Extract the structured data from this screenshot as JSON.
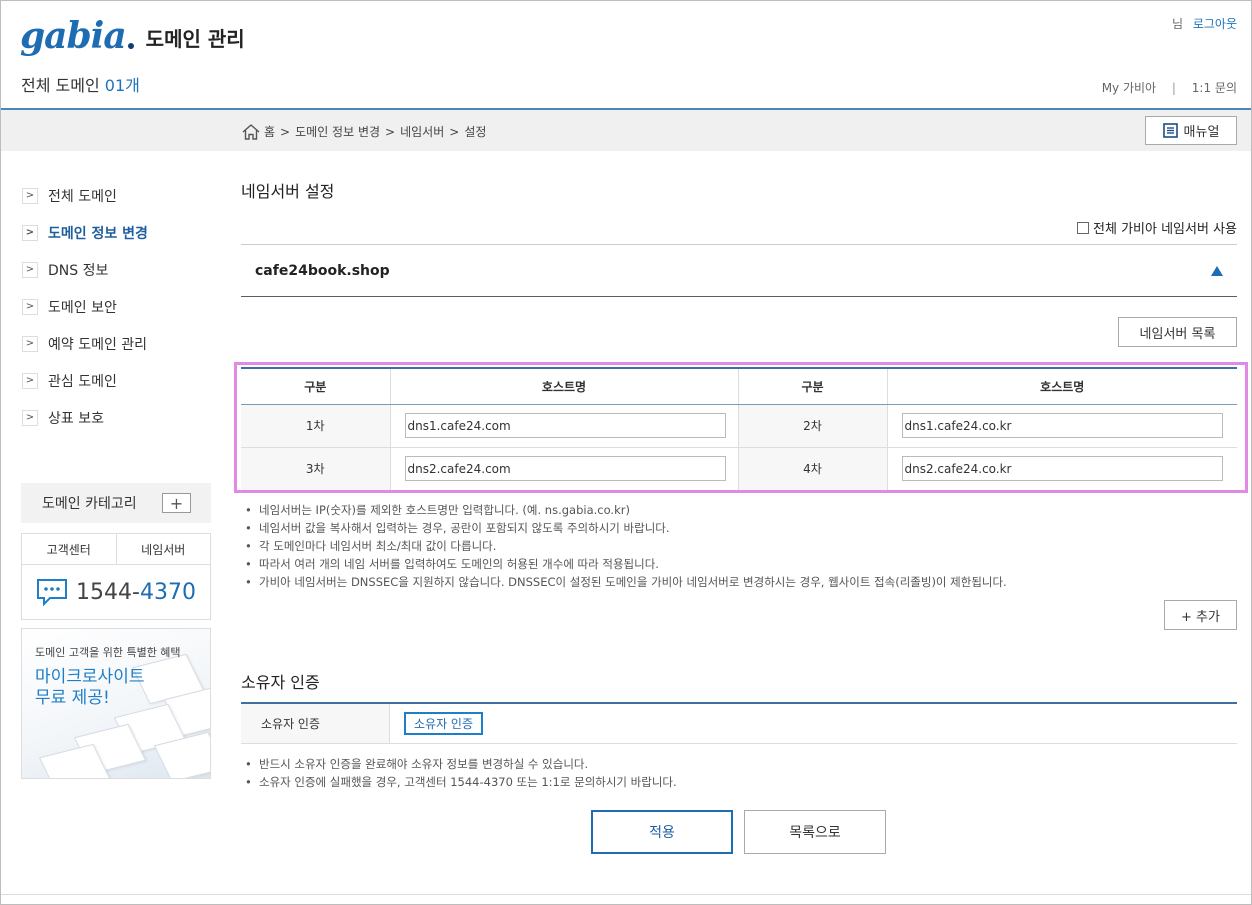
{
  "header": {
    "logo_text": "gabia",
    "title": "도메인 관리",
    "count_label": "전체 도메인",
    "count_value": "01개",
    "user_suffix": "님",
    "logout": "로그아웃",
    "my_gabia": "My 가비아",
    "separator": "|",
    "inquiry": "1:1 문의"
  },
  "breadcrumb": {
    "items": [
      "홈",
      ">",
      "도메인 정보 변경",
      ">",
      "네임서버",
      ">",
      "설정"
    ],
    "manual_button": "매뉴얼"
  },
  "sidebar": {
    "items": [
      {
        "label": "전체 도메인",
        "active": false
      },
      {
        "label": "도메인 정보 변경",
        "active": true
      },
      {
        "label": "DNS 정보",
        "active": false
      },
      {
        "label": "도메인 보안",
        "active": false
      },
      {
        "label": "예약 도메인 관리",
        "active": false
      },
      {
        "label": "관심 도메인",
        "active": false
      },
      {
        "label": "상표 보호",
        "active": false
      }
    ],
    "chevron": ">",
    "category_label": "도메인 카테고리",
    "category_plus": "+",
    "cs_tabs": [
      "고객센터",
      "네임서버"
    ],
    "phone_a": "1544-",
    "phone_b": "4370",
    "promo_small": "도메인 고객을 위한 특별한 혜택",
    "promo_big_1": "마이크로사이트",
    "promo_big_2": "무료 제공!"
  },
  "main": {
    "title": "네임서버 설정",
    "all_gabia_label": "전체 가비아 네임서버 사용",
    "domain": "cafe24book.shop",
    "ns_list_button": "네임서버 목록",
    "table": {
      "headers": [
        "구분",
        "호스트명",
        "구분",
        "호스트명"
      ],
      "rows": [
        {
          "label_a": "1차",
          "host_a": "dns1.cafe24.com",
          "label_b": "2차",
          "host_b": "dns1.cafe24.co.kr"
        },
        {
          "label_a": "3차",
          "host_a": "dns2.cafe24.com",
          "label_b": "4차",
          "host_b": "dns2.cafe24.co.kr"
        }
      ]
    },
    "notes": [
      "네임서버는 IP(숫자)를 제외한 호스트명만 입력합니다. (예. ns.gabia.co.kr)",
      "네임서버 값을 복사해서 입력하는 경우, 공란이 포함되지 않도록 주의하시기 바랍니다.",
      "각 도메인마다 네임서버 최소/최대 값이 다릅니다.",
      "따라서 여러 개의 네임 서버를 입력하여도 도메인의 허용된 개수에 따라 적용됩니다.",
      "가비아 네임서버는 DNSSEC을 지원하지 않습니다. DNSSEC이 설정된 도메인을 가비아 네임서버로 변경하시는 경우, 웹사이트 접속(리졸빙)이 제한됩니다."
    ],
    "add_button": "+ 추가",
    "owner_title": "소유자 인증",
    "owner_label": "소유자 인증",
    "owner_button": "소유자 인증",
    "owner_notes": [
      "반드시 소유자 인증을 완료해야 소유자 정보를 변경하실 수 있습니다.",
      "소유자 인증에 실패했을 경우, 고객센터 1544-4370 또는 1:1로 문의하시기 바랍니다."
    ],
    "apply_button": "적용",
    "list_button": "목록으로"
  },
  "colors": {
    "brand_blue": "#1e6cb2",
    "highlight": "#e08ae6",
    "header_rule": "#4a86b8"
  }
}
